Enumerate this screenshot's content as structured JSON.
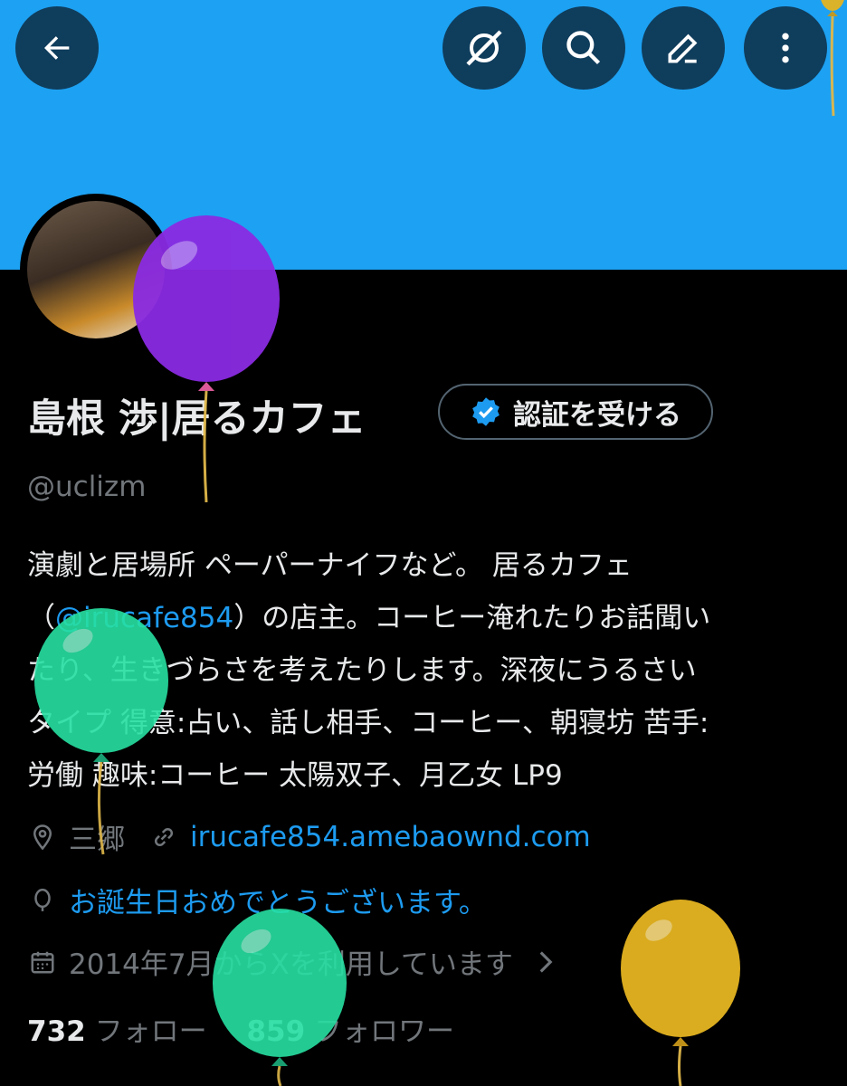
{
  "header": {
    "back_icon": "arrow-left-icon",
    "actions": [
      {
        "icon": "ai-sparkle-icon"
      },
      {
        "icon": "search-icon"
      },
      {
        "icon": "edit-pencil-icon"
      },
      {
        "icon": "more-vertical-icon"
      }
    ],
    "banner_color": "#1da1f2"
  },
  "profile": {
    "name": "島根 渉|居るカフェ",
    "handle": "@uclizm",
    "verify_button_label": "認証を受ける",
    "bio_lines": [
      "演劇と居場所 ペーパーナイフなど。 居るカフェ",
      [
        "（",
        "@irucafe854",
        "）の店主。コーヒー淹れたりお話聞い"
      ],
      "たり、生きづらさを考えたりします。深夜にうるさい",
      "タイプ 得意:占い、話し相手、コーヒー、朝寝坊 苦手:",
      "労働 趣味:コーヒー 太陽双子、月乙女 LP9"
    ],
    "location": "三郷",
    "website": "irucafe854.amebaownd.com",
    "birthday": "お誕生日おめでとうございます。",
    "joined": "2014年7月からXを利用しています",
    "following_count": "732",
    "following_label": "フォロー",
    "followers_count": "859",
    "followers_label": "フォロワー"
  },
  "colors": {
    "accent": "#1d9bf0",
    "muted": "#71767b",
    "text": "#e7e9ea"
  }
}
